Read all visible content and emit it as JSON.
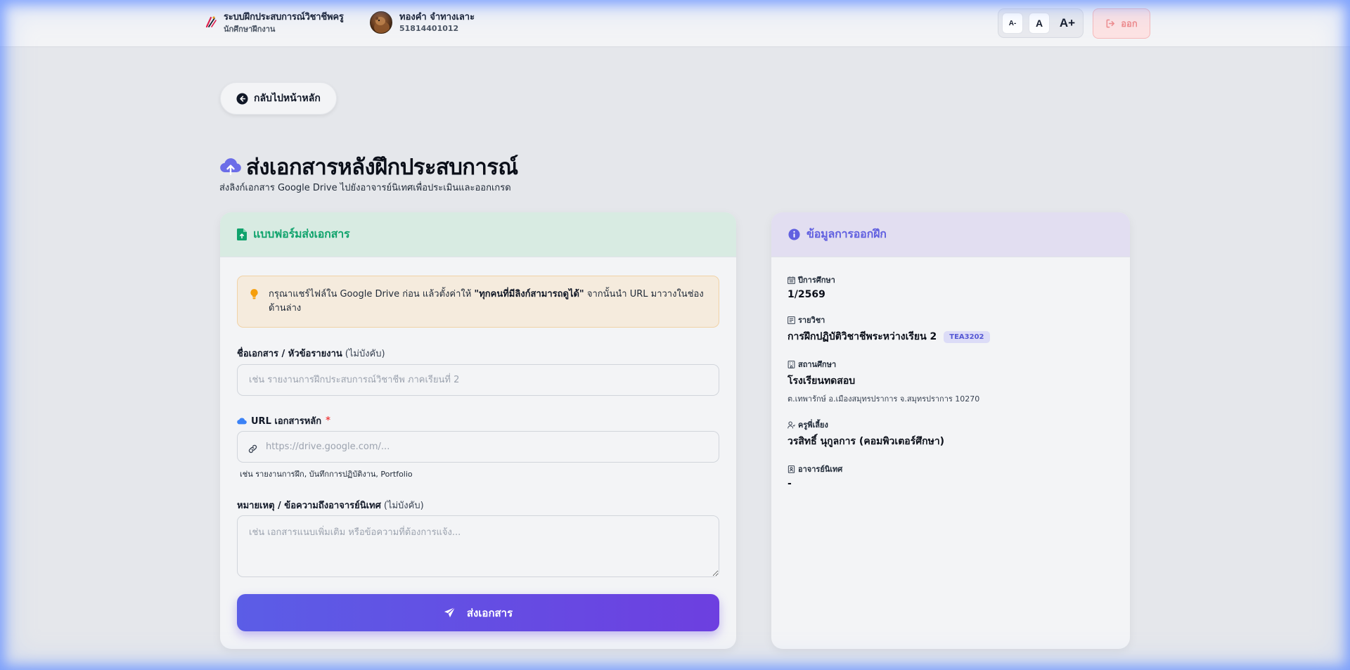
{
  "header": {
    "system_name": "ระบบฝึกประสบการณ์วิชาชีพครู",
    "role": "นักศึกษาฝึกงาน",
    "user_name": "ทองคำ จำทางเลาะ",
    "user_id": "51814401012",
    "font_smaller": "A-",
    "font_normal": "A",
    "font_larger": "A+",
    "logout_label": "ออก"
  },
  "back_label": "กลับไปหน้าหลัก",
  "page": {
    "title": "ส่งเอกสารหลังฝึกประสบการณ์",
    "subtitle": "ส่งลิงก์เอกสาร Google Drive ไปยังอาจารย์นิเทศเพื่อประเมินและออกเกรด"
  },
  "form": {
    "title": "แบบฟอร์มส่งเอกสาร",
    "alert_before": "กรุณาแชร์ไฟล์ใน Google Drive ก่อน แล้วตั้งค่าให้ ",
    "alert_bold": "\"ทุกคนที่มีลิงก์สามารถดูได้\"",
    "alert_after": " จากนั้นนำ URL มาวางในช่องด้านล่าง",
    "doc_name_label": "ชื่อเอกสาร / หัวข้อรายงาน",
    "optional": "(ไม่บังคับ)",
    "doc_name_placeholder": "เช่น รายงานการฝึกประสบการณ์วิชาชีพ ภาคเรียนที่ 2",
    "url_label": "URL เอกสารหลัก",
    "required_mark": "*",
    "url_placeholder": "https://drive.google.com/...",
    "url_help": "เช่น รายงานการฝึก, บันทึกการปฏิบัติงาน, Portfolio",
    "note_label": "หมายเหตุ / ข้อความถึงอาจารย์นิเทศ",
    "note_placeholder": "เช่น เอกสารแนบเพิ่มเติม หรือข้อความที่ต้องการแจ้ง...",
    "submit_label": "ส่งเอกสาร"
  },
  "info": {
    "title": "ข้อมูลการออกฝึก",
    "year_label": "ปีการศึกษา",
    "year_value": "1/2569",
    "course_label": "รายวิชา",
    "course_value": "การฝึกปฏิบัติวิชาชีพระหว่างเรียน 2",
    "course_code": "TEA3202",
    "school_label": "สถานศึกษา",
    "school_value": "โรงเรียนทดสอบ",
    "school_address": "ต.เทพารักษ์ อ.เมืองสมุทรปราการ จ.สมุทรปราการ 10270",
    "mentor_label": "ครูพี่เลี้ยง",
    "mentor_value": "วรสิทธิ์ นุกูลการ (คอมพิวเตอร์ศึกษา)",
    "supervisor_label": "อาจารย์นิเทศ",
    "supervisor_value": "-"
  },
  "colors": {
    "accent": "#6160e0",
    "success": "#10a36c",
    "danger": "#ef4444",
    "warning": "#f59e0b"
  }
}
